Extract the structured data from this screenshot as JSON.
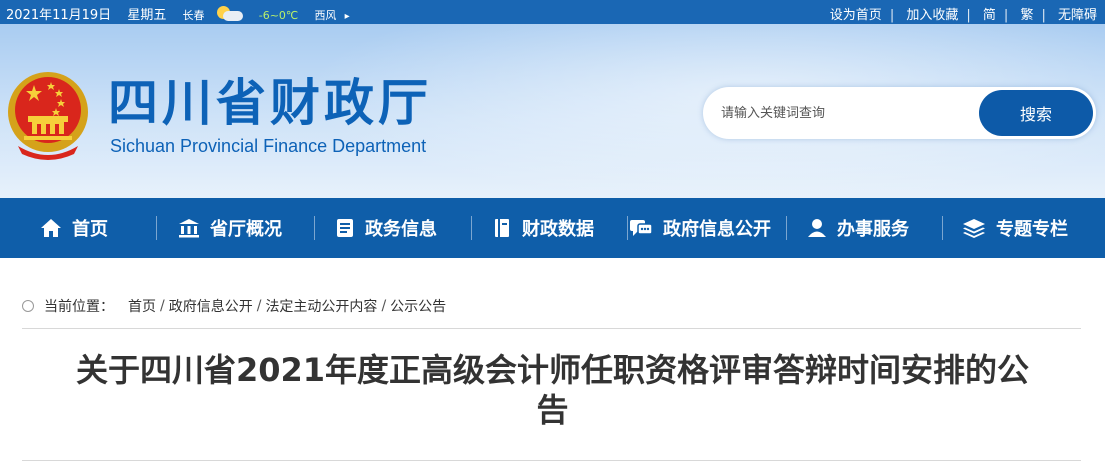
{
  "topbar": {
    "date": "2021年11月19日",
    "weekday": "星期五",
    "city": "长春",
    "temperature": "-6~0℃",
    "wind": "西风",
    "weather_icon": "partly-cloudy-icon",
    "links": [
      "设为首页",
      "加入收藏",
      "简",
      "繁",
      "无障碍"
    ]
  },
  "header": {
    "title_cn": "四川省财政厅",
    "title_en": "Sichuan Provincial Finance Department"
  },
  "search": {
    "placeholder": "请输入关键词查询",
    "button_label": "搜索"
  },
  "nav": {
    "items": [
      {
        "label": "首页",
        "icon": "home-icon"
      },
      {
        "label": "省厅概况",
        "icon": "building-icon"
      },
      {
        "label": "政务信息",
        "icon": "document-icon"
      },
      {
        "label": "财政数据",
        "icon": "book-icon"
      },
      {
        "label": "政府信息公开",
        "icon": "chat-icon"
      },
      {
        "label": "办事服务",
        "icon": "user-icon"
      },
      {
        "label": "专题专栏",
        "icon": "layers-icon"
      }
    ]
  },
  "breadcrumb": {
    "label": "当前位置：",
    "items": [
      "首页",
      "政府信息公开",
      "法定主动公开内容",
      "公示公告"
    ]
  },
  "article": {
    "title": "关于四川省2021年度正高级会计师任职资格评审答辩时间安排的公告"
  },
  "colors": {
    "brand_blue": "#0f5ea9",
    "title_blue": "#0d62b7",
    "topbar_blue": "#1a67b4"
  }
}
